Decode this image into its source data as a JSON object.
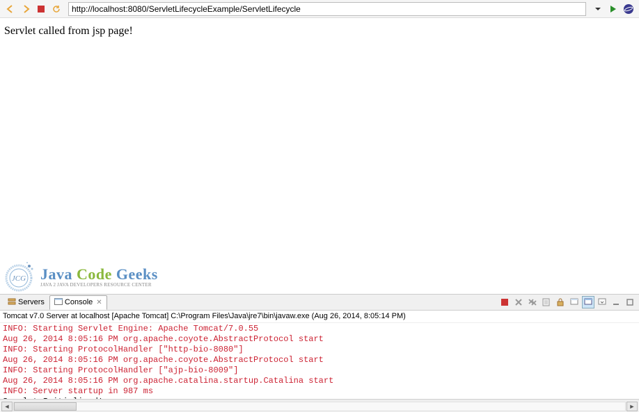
{
  "toolbar": {
    "url": "http://localhost:8080/ServletLifecycleExample/ServletLifecycle"
  },
  "page": {
    "content": "Servlet called from jsp page!"
  },
  "logo": {
    "main_java": "Java",
    "main_code": "Code",
    "main_geeks": "Geeks",
    "sub": "Java 2 Java Developers Resource Center",
    "badge": "JCG"
  },
  "tabs": {
    "servers": {
      "label": "Servers"
    },
    "console": {
      "label": "Console"
    }
  },
  "console": {
    "header": "Tomcat v7.0 Server at localhost [Apache Tomcat] C:\\Program Files\\Java\\jre7\\bin\\javaw.exe (Aug 26, 2014, 8:05:14 PM)",
    "lines": [
      {
        "cls": "red",
        "text": "INFO: Starting Servlet Engine: Apache Tomcat/7.0.55"
      },
      {
        "cls": "red",
        "text": "Aug 26, 2014 8:05:16 PM org.apache.coyote.AbstractProtocol start"
      },
      {
        "cls": "red",
        "text": "INFO: Starting ProtocolHandler [\"http-bio-8080\"]"
      },
      {
        "cls": "red",
        "text": "Aug 26, 2014 8:05:16 PM org.apache.coyote.AbstractProtocol start"
      },
      {
        "cls": "red",
        "text": "INFO: Starting ProtocolHandler [\"ajp-bio-8009\"]"
      },
      {
        "cls": "red",
        "text": "Aug 26, 2014 8:05:16 PM org.apache.catalina.startup.Catalina start"
      },
      {
        "cls": "red",
        "text": "INFO: Server startup in 987 ms"
      },
      {
        "cls": "black",
        "text": "Servlet Initialized!"
      }
    ]
  }
}
